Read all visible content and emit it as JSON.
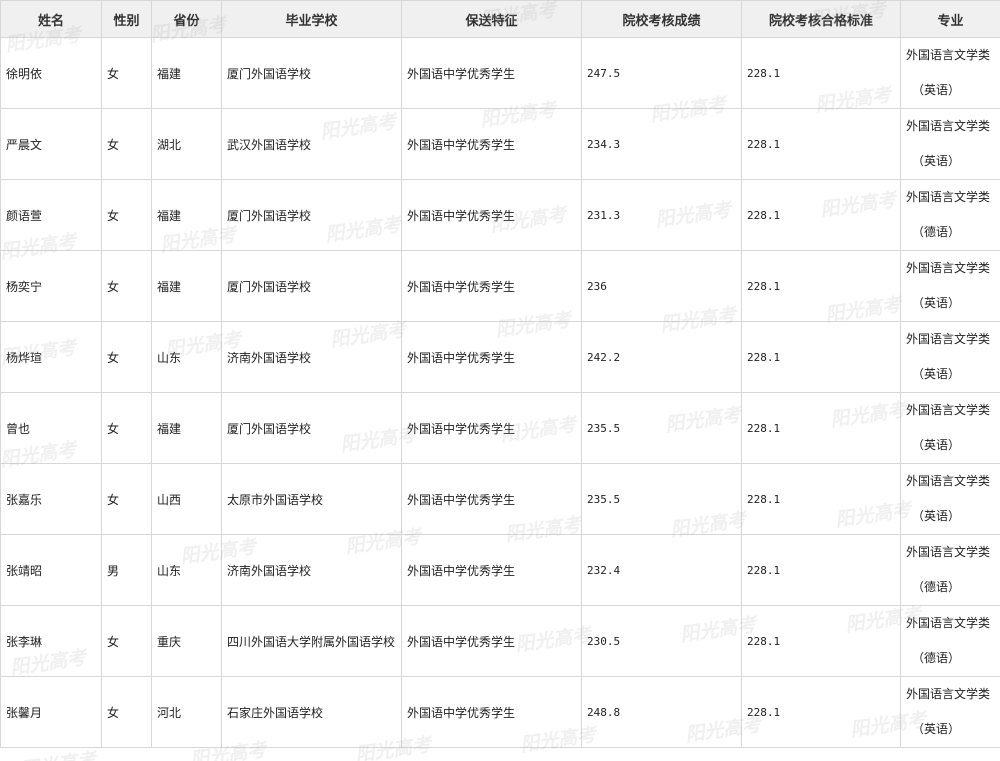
{
  "headers": [
    "姓名",
    "性别",
    "省份",
    "毕业学校",
    "保送特征",
    "院校考核成绩",
    "院校考核合格标准",
    "专业"
  ],
  "rows": [
    {
      "name": "徐明依",
      "gender": "女",
      "province": "福建",
      "school": "厦门外国语学校",
      "feature": "外国语中学优秀学生",
      "score": "247.5",
      "standard": "228.1",
      "major": "外国语言文学类",
      "major_sub": "（英语）"
    },
    {
      "name": "严晨文",
      "gender": "女",
      "province": "湖北",
      "school": "武汉外国语学校",
      "feature": "外国语中学优秀学生",
      "score": "234.3",
      "standard": "228.1",
      "major": "外国语言文学类",
      "major_sub": "（英语）"
    },
    {
      "name": "颜语萱",
      "gender": "女",
      "province": "福建",
      "school": "厦门外国语学校",
      "feature": "外国语中学优秀学生",
      "score": "231.3",
      "standard": "228.1",
      "major": "外国语言文学类",
      "major_sub": "（德语）"
    },
    {
      "name": "杨奕宁",
      "gender": "女",
      "province": "福建",
      "school": "厦门外国语学校",
      "feature": "外国语中学优秀学生",
      "score": "236",
      "standard": "228.1",
      "major": "外国语言文学类",
      "major_sub": "（英语）"
    },
    {
      "name": "杨烨瑄",
      "gender": "女",
      "province": "山东",
      "school": "济南外国语学校",
      "feature": "外国语中学优秀学生",
      "score": "242.2",
      "standard": "228.1",
      "major": "外国语言文学类",
      "major_sub": "（英语）"
    },
    {
      "name": "曾也",
      "gender": "女",
      "province": "福建",
      "school": "厦门外国语学校",
      "feature": "外国语中学优秀学生",
      "score": "235.5",
      "standard": "228.1",
      "major": "外国语言文学类",
      "major_sub": "（英语）"
    },
    {
      "name": "张嘉乐",
      "gender": "女",
      "province": "山西",
      "school": "太原市外国语学校",
      "feature": "外国语中学优秀学生",
      "score": "235.5",
      "standard": "228.1",
      "major": "外国语言文学类",
      "major_sub": "（英语）"
    },
    {
      "name": "张靖昭",
      "gender": "男",
      "province": "山东",
      "school": "济南外国语学校",
      "feature": "外国语中学优秀学生",
      "score": "232.4",
      "standard": "228.1",
      "major": "外国语言文学类",
      "major_sub": "（德语）"
    },
    {
      "name": "张李琳",
      "gender": "女",
      "province": "重庆",
      "school": "四川外国语大学附属外国语学校",
      "feature": "外国语中学优秀学生",
      "score": "230.5",
      "standard": "228.1",
      "major": "外国语言文学类",
      "major_sub": "（德语）"
    },
    {
      "name": "张馨月",
      "gender": "女",
      "province": "河北",
      "school": "石家庄外国语学校",
      "feature": "外国语中学优秀学生",
      "score": "248.8",
      "standard": "228.1",
      "major": "外国语言文学类",
      "major_sub": "（英语）"
    }
  ],
  "watermark": "阳光高考"
}
